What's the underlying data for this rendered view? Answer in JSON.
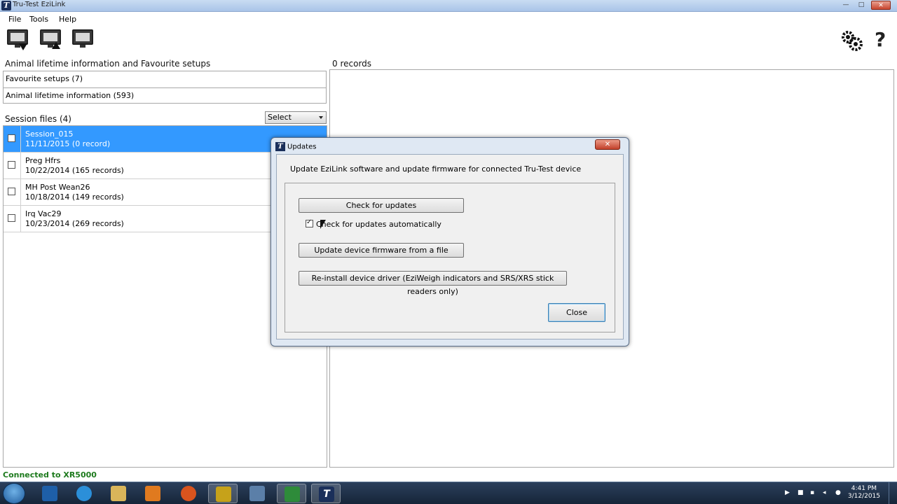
{
  "window": {
    "title": "Tru-Test EziLink",
    "min_glyph": "—",
    "max_glyph": "□",
    "close_glyph": "✕"
  },
  "menu": {
    "file": "File",
    "tools": "Tools",
    "help": "Help"
  },
  "icons": {
    "app": "T",
    "help": "?"
  },
  "left": {
    "lifetime_heading": "Animal lifetime information and Favourite setups",
    "favourite": "Favourite setups (7)",
    "lifetime": "Animal lifetime information (593)",
    "session_heading": "Session files (4)",
    "select_label": "Select",
    "sessions": [
      {
        "name": "Session_015",
        "meta": "11/11/2015  (0 record)"
      },
      {
        "name": "Preg Hfrs",
        "meta": "10/22/2014  (165 records)"
      },
      {
        "name": "MH Post Wean26",
        "meta": "10/18/2014  (149 records)"
      },
      {
        "name": "Irq Vac29",
        "meta": "10/23/2014  (269 records)"
      }
    ]
  },
  "right": {
    "records_heading": "0 records"
  },
  "status": "Connected to XR5000",
  "dialog": {
    "title": "Updates",
    "close_glyph": "✕",
    "description": "Update EziLink software and update firmware for connected Tru-Test device",
    "check_button": "Check for updates",
    "auto_check": "Check for updates automatically",
    "firmware_button": "Update device firmware from a file",
    "reinstall_button": "Re-install device driver (EziWeigh indicators and SRS/XRS stick readers only)",
    "close_button": "Close"
  },
  "taskbar": {
    "time": "4:41 PM",
    "date": "3/12/2015"
  },
  "colors": {
    "selection": "#3399ff",
    "status": "#1d7a1d",
    "taskbar": "#1f3350"
  }
}
